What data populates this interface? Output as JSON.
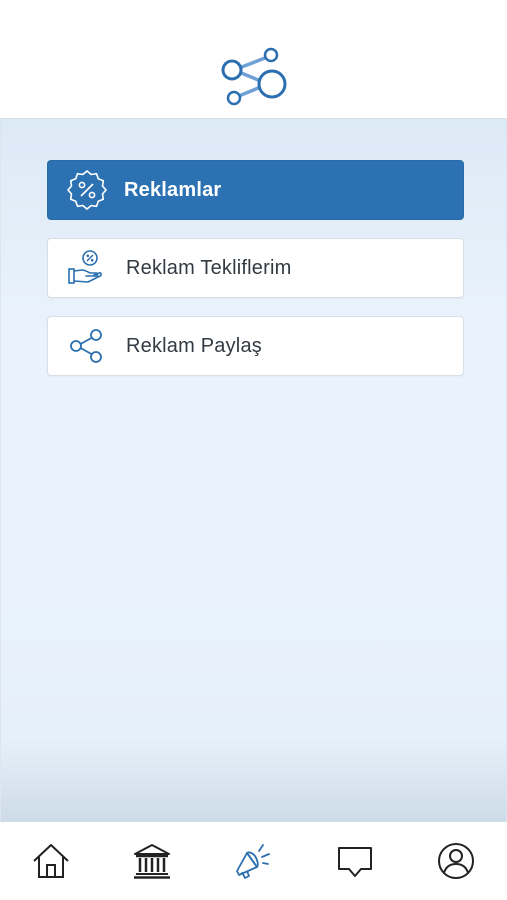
{
  "header": {
    "logo_icon": "share-network-icon",
    "accent_color": "#2c72b3"
  },
  "menu": {
    "items": [
      {
        "label": "Reklamlar",
        "icon": "discount-badge-icon",
        "active": true
      },
      {
        "label": "Reklam Tekliflerim",
        "icon": "hand-offer-icon",
        "active": false
      },
      {
        "label": "Reklam Paylaş",
        "icon": "share-icon",
        "active": false
      }
    ]
  },
  "bottom_nav": {
    "items": [
      {
        "icon": "home-icon",
        "active": false
      },
      {
        "icon": "bank-icon",
        "active": false
      },
      {
        "icon": "megaphone-icon",
        "active": true
      },
      {
        "icon": "chat-icon",
        "active": false
      },
      {
        "icon": "profile-icon",
        "active": false
      }
    ]
  }
}
